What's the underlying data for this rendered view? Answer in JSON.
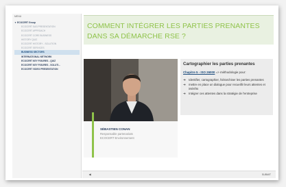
{
  "sidebar": {
    "menu_label": "MENU",
    "items": [
      {
        "label": "ECOCERT Group",
        "kind": "group"
      },
      {
        "label": "ECOCERT SAS PRESENTATION",
        "kind": "item"
      },
      {
        "label": "ECOCERT APPROACH",
        "kind": "item"
      },
      {
        "label": "ECOCERT CORE BUSINESS",
        "kind": "item"
      },
      {
        "label": "HISTORY QUIZ",
        "kind": "item"
      },
      {
        "label": "ECOCERT HISTORY - SOLUTION",
        "kind": "item"
      },
      {
        "label": "ECOCERT SERVICES",
        "kind": "item"
      },
      {
        "label": "BUSINESS SECTORS",
        "kind": "active"
      },
      {
        "label": "INTERNATIONAL NETWORK",
        "kind": "dark"
      },
      {
        "label": "ECOCERT KEY FIGURES - QUIZ",
        "kind": "dark"
      },
      {
        "label": "ECOCERT KEY FIGURES - SOLUTI...",
        "kind": "dark"
      },
      {
        "label": "ECOCERT VIDEO PRESENTATION",
        "kind": "dark"
      }
    ]
  },
  "main": {
    "title_line1": "COMMENT INTÉGRER LES PARTIES PRENANTES",
    "title_line2": "DANS SA DÉMARCHE RSE ?",
    "speaker": {
      "name": "SÉBASTIEN CONAN",
      "role": "Responsable partenariats",
      "org": "ECOCERT Environnement"
    },
    "panel": {
      "title": "Cartographier les parties prenantes",
      "ref_link": "Chapitre 5 - ISO 26000",
      "ref_rest": " => méthodologie pour:",
      "bullets": [
        "Identifier, cartographier, hiérarchiser les parties prenantes",
        "mettre en place un dialogue pour recueillir leurs attentes et intérêts",
        "Intégrer ces attentes dans la stratégie de l'entreprise"
      ]
    }
  },
  "footer": {
    "prev_label": "◀",
    "submit_label": "SUBMIT"
  },
  "colors": {
    "accent_green": "#8fc34a",
    "title_bg": "#e9f1e1",
    "active_item_bg": "#cfe0ee",
    "navy": "#2a3e5c"
  },
  "icons": {
    "bullet": "arrow-right-icon",
    "prev": "chevron-left-icon"
  }
}
